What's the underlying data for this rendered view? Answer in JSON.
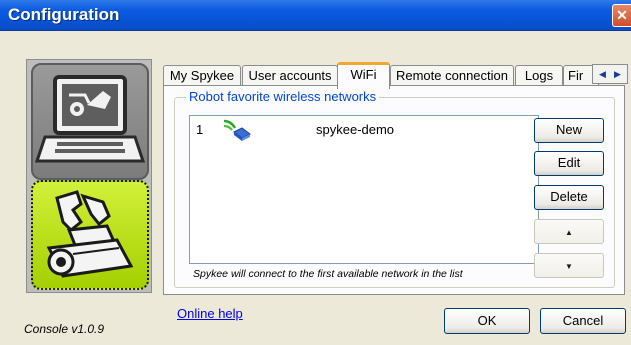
{
  "window": {
    "title": "Configuration",
    "close_glyph": "✕"
  },
  "tabs": [
    {
      "label": "My Spykee",
      "active": false
    },
    {
      "label": "User accounts",
      "active": false
    },
    {
      "label": "WiFi",
      "active": true
    },
    {
      "label": "Remote connection",
      "active": false
    },
    {
      "label": "Logs",
      "active": false
    },
    {
      "label": "Fir",
      "active": false
    }
  ],
  "tab_scroll": {
    "left": "◀",
    "right": "▶"
  },
  "wifi": {
    "group_title": "Robot favorite wireless networks",
    "networks": [
      {
        "index": "1",
        "name": "spykee-demo",
        "icon": "wireless-network-icon"
      }
    ],
    "hint": "Spykee will connect to the first available network in the list",
    "buttons": {
      "new": "New",
      "edit": "Edit",
      "delete": "Delete",
      "up": "▲",
      "down": "▼"
    }
  },
  "side_panel": {
    "items": [
      {
        "name": "laptop-mode",
        "icon": "laptop-robot-icon",
        "selected": false
      },
      {
        "name": "robot-mode",
        "icon": "robot-icon",
        "selected": true
      }
    ]
  },
  "footer": {
    "version": "Console v1.0.9",
    "help": "Online help",
    "ok": "OK",
    "cancel": "Cancel"
  },
  "colors": {
    "title_bar": "#0854d8",
    "robot_tile": "#b6e01e",
    "tab_highlight": "#f0a830",
    "link": "#0000ee"
  }
}
